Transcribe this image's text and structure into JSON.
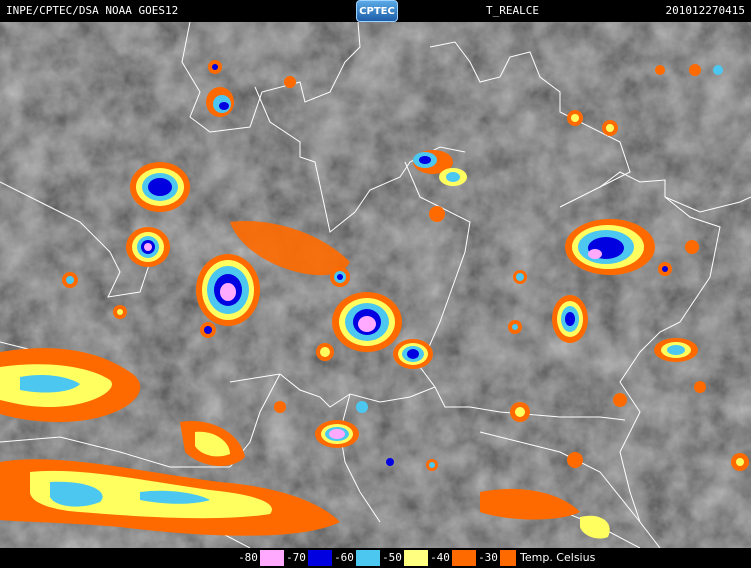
{
  "header": {
    "source": "INPE/CPTEC/DSA NOAA GOES12",
    "logo": "CPTEC",
    "product": "T_REALCE",
    "timestamp": "201012270415"
  },
  "legend": {
    "unit": "Temp. Celsius",
    "bins": [
      {
        "value": "-80",
        "color": "#ffaaff"
      },
      {
        "value": "-70",
        "color": "#0000e0"
      },
      {
        "value": "-60",
        "color": "#4cc8f0"
      },
      {
        "value": "-50",
        "color": "#ffff80"
      },
      {
        "value": "-40",
        "color": "#ff6a00"
      },
      {
        "value": "-30",
        "color": "#ff6a00"
      }
    ]
  },
  "colors": {
    "cloud_cold": "#ffaaff",
    "deep_blue": "#0000e0",
    "cyan": "#4cc8f0",
    "yellow": "#ffff60",
    "orange": "#ff6a00",
    "background_gray": "#6a6a6a",
    "boundary": "#ffffff"
  }
}
